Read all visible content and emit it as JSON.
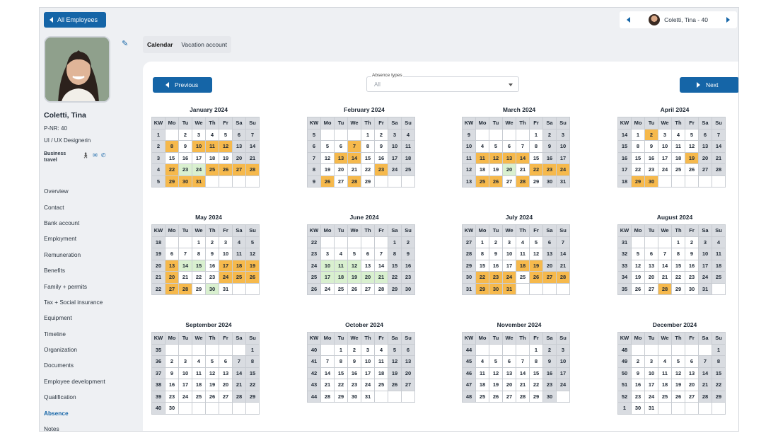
{
  "header": {
    "back_label": "All Employees",
    "employee_switch_label": "Coletti, Tina - 40"
  },
  "profile": {
    "name": "Coletti, Tina",
    "pnr": "P-NR: 40",
    "role": "UI / UX Designerin",
    "status": "Business travel"
  },
  "sidebar": {
    "items": [
      "Overview",
      "Contact",
      "Bank account",
      "Employment",
      "Remuneration",
      "Benefits",
      "Family + permits",
      "Tax + Social insurance",
      "Equipment",
      "Timeline",
      "Organization",
      "Documents",
      "Employee development",
      "Qualification",
      "Absence",
      "Notes"
    ],
    "active": "Absence"
  },
  "tabs": [
    "Calendar",
    "Vacation account"
  ],
  "toolbar": {
    "previous_label": "Previous",
    "next_label": "Next",
    "absence_label": "Absence types",
    "absence_value": "All"
  },
  "calendar": {
    "weekday_headers": [
      "KW",
      "Mo",
      "Tu",
      "We",
      "Th",
      "Fr",
      "Sa",
      "Su"
    ],
    "legend_colors": {
      "vacation": "#f6b94c",
      "sick": "#d9f0cf",
      "weekend": "#d9dce1"
    },
    "months": [
      {
        "title": "January 2024",
        "rows": [
          [
            "1",
            "",
            "2",
            "3",
            "4",
            "5",
            "6",
            "7"
          ],
          [
            "2",
            "8",
            "9",
            "10",
            "11",
            "12",
            "13",
            "14"
          ],
          [
            "3",
            "15",
            "16",
            "17",
            "18",
            "19",
            "20",
            "21"
          ],
          [
            "4",
            "22",
            "23",
            "24",
            "25",
            "26",
            "27",
            "28"
          ],
          [
            "5",
            "29",
            "30",
            "31",
            "",
            "",
            "",
            ""
          ]
        ]
      },
      {
        "title": "February 2024",
        "rows": [
          [
            "5",
            "",
            "",
            "",
            "1",
            "2",
            "3",
            "4"
          ],
          [
            "6",
            "5",
            "6",
            "7",
            "8",
            "9",
            "10",
            "11"
          ],
          [
            "7",
            "12",
            "13",
            "14",
            "15",
            "16",
            "17",
            "18"
          ],
          [
            "8",
            "19",
            "20",
            "21",
            "22",
            "23",
            "24",
            "25"
          ],
          [
            "9",
            "26",
            "27",
            "28",
            "29",
            "",
            "",
            ""
          ]
        ]
      },
      {
        "title": "March 2024",
        "rows": [
          [
            "9",
            "",
            "",
            "",
            "",
            "1",
            "2",
            "3"
          ],
          [
            "10",
            "4",
            "5",
            "6",
            "7",
            "8",
            "9",
            "10"
          ],
          [
            "11",
            "11",
            "12",
            "13",
            "14",
            "15",
            "16",
            "17"
          ],
          [
            "12",
            "18",
            "19",
            "20",
            "21",
            "22",
            "23",
            "24"
          ],
          [
            "13",
            "25",
            "26",
            "27",
            "28",
            "29",
            "30",
            "31"
          ]
        ]
      },
      {
        "title": "April 2024",
        "rows": [
          [
            "14",
            "1",
            "2",
            "3",
            "4",
            "5",
            "6",
            "7"
          ],
          [
            "15",
            "8",
            "9",
            "10",
            "11",
            "12",
            "13",
            "14"
          ],
          [
            "16",
            "15",
            "16",
            "17",
            "18",
            "19",
            "20",
            "21"
          ],
          [
            "17",
            "22",
            "23",
            "24",
            "25",
            "26",
            "27",
            "28"
          ],
          [
            "18",
            "29",
            "30",
            "",
            "",
            "",
            "",
            ""
          ]
        ]
      },
      {
        "title": "May 2024",
        "rows": [
          [
            "18",
            "",
            "",
            "1",
            "2",
            "3",
            "4",
            "5"
          ],
          [
            "19",
            "6",
            "7",
            "8",
            "9",
            "10",
            "11",
            "12"
          ],
          [
            "20",
            "13",
            "14",
            "15",
            "16",
            "17",
            "18",
            "19"
          ],
          [
            "21",
            "20",
            "21",
            "22",
            "23",
            "24",
            "25",
            "26"
          ],
          [
            "22",
            "27",
            "28",
            "29",
            "30",
            "31",
            "",
            ""
          ]
        ]
      },
      {
        "title": "June 2024",
        "rows": [
          [
            "22",
            "",
            "",
            "",
            "",
            "",
            "1",
            "2"
          ],
          [
            "23",
            "3",
            "4",
            "5",
            "6",
            "7",
            "8",
            "9"
          ],
          [
            "24",
            "10",
            "11",
            "12",
            "13",
            "14",
            "15",
            "16"
          ],
          [
            "25",
            "17",
            "18",
            "19",
            "20",
            "21",
            "22",
            "23"
          ],
          [
            "26",
            "24",
            "25",
            "26",
            "27",
            "28",
            "29",
            "30"
          ]
        ]
      },
      {
        "title": "July 2024",
        "rows": [
          [
            "27",
            "1",
            "2",
            "3",
            "4",
            "5",
            "6",
            "7"
          ],
          [
            "28",
            "8",
            "9",
            "10",
            "11",
            "12",
            "13",
            "14"
          ],
          [
            "29",
            "15",
            "16",
            "17",
            "18",
            "19",
            "20",
            "21"
          ],
          [
            "30",
            "22",
            "23",
            "24",
            "25",
            "26",
            "27",
            "28"
          ],
          [
            "31",
            "29",
            "30",
            "31",
            "",
            "",
            "",
            ""
          ]
        ]
      },
      {
        "title": "August 2024",
        "rows": [
          [
            "31",
            "",
            "",
            "",
            "1",
            "2",
            "3",
            "4"
          ],
          [
            "32",
            "5",
            "6",
            "7",
            "8",
            "9",
            "10",
            "11"
          ],
          [
            "33",
            "12",
            "13",
            "14",
            "15",
            "16",
            "17",
            "18"
          ],
          [
            "34",
            "19",
            "20",
            "21",
            "22",
            "23",
            "24",
            "25"
          ],
          [
            "35",
            "26",
            "27",
            "28",
            "29",
            "30",
            "31",
            ""
          ]
        ]
      },
      {
        "title": "September 2024",
        "rows": [
          [
            "35",
            "",
            "",
            "",
            "",
            "",
            "",
            "1"
          ],
          [
            "36",
            "2",
            "3",
            "4",
            "5",
            "6",
            "7",
            "8"
          ],
          [
            "37",
            "9",
            "10",
            "11",
            "12",
            "13",
            "14",
            "15"
          ],
          [
            "38",
            "16",
            "17",
            "18",
            "19",
            "20",
            "21",
            "22"
          ],
          [
            "39",
            "23",
            "24",
            "25",
            "26",
            "27",
            "28",
            "29"
          ],
          [
            "40",
            "30",
            "",
            "",
            "",
            "",
            "",
            ""
          ]
        ]
      },
      {
        "title": "October 2024",
        "rows": [
          [
            "40",
            "",
            "1",
            "2",
            "3",
            "4",
            "5",
            "6"
          ],
          [
            "41",
            "7",
            "8",
            "9",
            "10",
            "11",
            "12",
            "13"
          ],
          [
            "42",
            "14",
            "15",
            "16",
            "17",
            "18",
            "19",
            "20"
          ],
          [
            "43",
            "21",
            "22",
            "23",
            "24",
            "25",
            "26",
            "27"
          ],
          [
            "44",
            "28",
            "29",
            "30",
            "31",
            "",
            "",
            ""
          ]
        ]
      },
      {
        "title": "November 2024",
        "rows": [
          [
            "44",
            "",
            "",
            "",
            "",
            "1",
            "2",
            "3"
          ],
          [
            "45",
            "4",
            "5",
            "6",
            "7",
            "8",
            "9",
            "10"
          ],
          [
            "46",
            "11",
            "12",
            "13",
            "14",
            "15",
            "16",
            "17"
          ],
          [
            "47",
            "18",
            "19",
            "20",
            "21",
            "22",
            "23",
            "24"
          ],
          [
            "48",
            "25",
            "26",
            "27",
            "28",
            "29",
            "30",
            ""
          ]
        ]
      },
      {
        "title": "December 2024",
        "rows": [
          [
            "48",
            "",
            "",
            "",
            "",
            "",
            "",
            "1"
          ],
          [
            "49",
            "2",
            "3",
            "4",
            "5",
            "6",
            "7",
            "8"
          ],
          [
            "50",
            "9",
            "10",
            "11",
            "12",
            "13",
            "14",
            "15"
          ],
          [
            "51",
            "16",
            "17",
            "18",
            "19",
            "20",
            "21",
            "22"
          ],
          [
            "52",
            "23",
            "24",
            "25",
            "26",
            "27",
            "28",
            "29"
          ],
          [
            "1",
            "30",
            "31",
            "",
            "",
            "",
            "",
            ""
          ]
        ]
      }
    ]
  }
}
